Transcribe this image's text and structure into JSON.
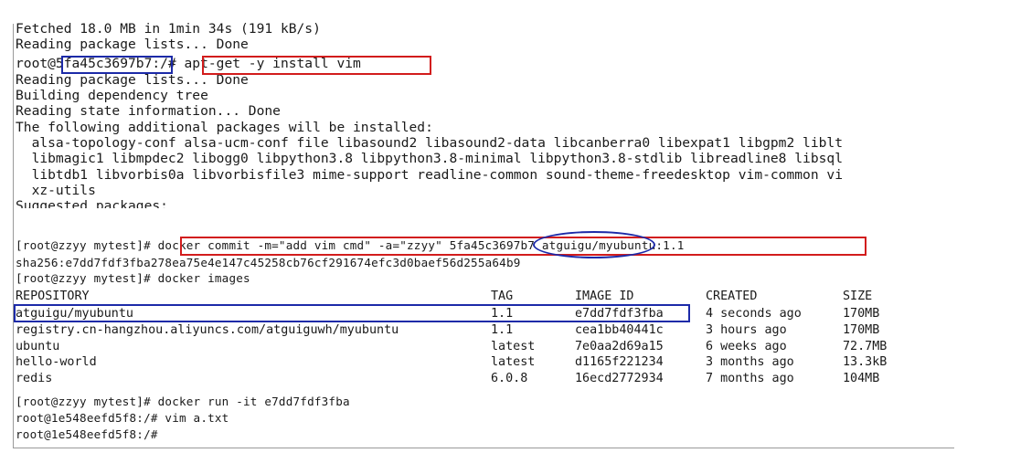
{
  "terminal": {
    "lines": [
      "Fetched 18.0 MB in 1min 34s (191 kB/s)",
      "Reading package lists... Done",
      "root@5fa45c3697b7:/# apt-get -y install vim",
      "Reading package lists... Done",
      "Building dependency tree",
      "Reading state information... Done",
      "The following additional packages will be installed:",
      "  alsa-topology-conf alsa-ucm-conf file libasound2 libasound2-data libcanberra0 libexpat1 libgpm2 liblt",
      "  libmagic1 libmpdec2 libogg0 libpython3.8 libpython3.8-minimal libpython3.8-stdlib libreadline8 libsql",
      "  libtdb1 libvorbis0a libvorbisfile3 mime-support readline-common sound-theme-freedesktop vim-common vi",
      "  xz-utils",
      "Suggested packages:",
      "[root@zzyy mytest]# docker commit -m=\"add vim cmd\" -a=\"zzyy\" 5fa45c3697b7 atguigu/myubuntu:1.1",
      "sha256:e7dd7fdf3fba278ea75e4e147c45258cb76cf291674efc3d0baef56d255a64b9",
      "[root@zzyy mytest]# docker images"
    ],
    "images_table": {
      "headers": [
        "REPOSITORY",
        "TAG",
        "IMAGE ID",
        "CREATED",
        "SIZE"
      ],
      "rows": [
        [
          "atguigu/myubuntu",
          "1.1",
          "e7dd7fdf3fba",
          "4 seconds ago",
          "170MB"
        ],
        [
          "registry.cn-hangzhou.aliyuncs.com/atguiguwh/myubuntu",
          "1.1",
          "cea1bb40441c",
          "3 hours ago",
          "170MB"
        ],
        [
          "ubuntu",
          "latest",
          "7e0aa2d69a15",
          "6 weeks ago",
          "72.7MB"
        ],
        [
          "hello-world",
          "latest",
          "d1165f221234",
          "3 months ago",
          "13.3kB"
        ],
        [
          "redis",
          "6.0.8",
          "16ecd2772934",
          "7 months ago",
          "104MB"
        ]
      ]
    },
    "trailing_lines": [
      "[root@zzyy mytest]# docker run -it e7dd7fdf3fba",
      "root@1e548eefd5f8:/# vim a.txt",
      "root@1e548eefd5f8:/#"
    ]
  },
  "annotation_colors": {
    "red": "#d21c1c",
    "blue": "#1c2aa8"
  }
}
